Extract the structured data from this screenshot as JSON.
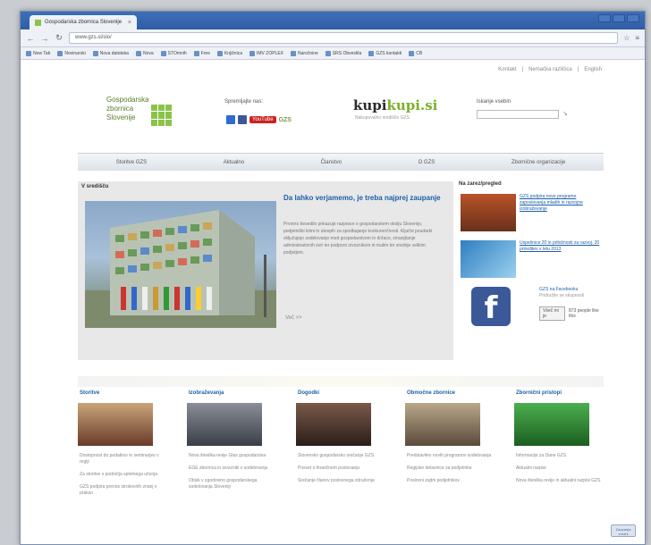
{
  "browser": {
    "tab_title": "Gospodarska zbornica Slovenije",
    "url": "www.gzs.si/slo/",
    "bookmarks": [
      "New Tab",
      "Novinarski",
      "Nova datoteka",
      "Nova",
      "STOmnih",
      "Free",
      "Knjižnica",
      "IMV ZOPLEX",
      "Naročnine",
      "SRS Obvestila",
      "GZS kontakti",
      "CB"
    ]
  },
  "site": {
    "top_links": [
      "Kontakt",
      "Nemačka različica",
      "English"
    ],
    "logo_lines": [
      "Gospodarska",
      "zbornica",
      "Slovenije"
    ],
    "social_label": "Spremljajte nas:",
    "youtube_label": "YouTube",
    "gzs_label": "GZS",
    "kupi_part1": "kupi",
    "kupi_part2": "kupi.si",
    "kupi_sub": "Nakupovalno središče GZS",
    "search_label": "Iskanje vsebin",
    "search_placeholder": ""
  },
  "nav": [
    "Storitve GZS",
    "Aktualno",
    "Članstvo",
    "O GZS",
    "Zbornične organizacije"
  ],
  "featured": {
    "section": "V središču",
    "headline": "Da lahko verjamemo, je treba najprej zaupanje",
    "body": "Prvotno besedilo prikazuje razpravo o gospodarskem okolju Slovenije, podjetniški klimi in ukrepih za spodbujanje konkurenčnosti. Ključni poudarki vključujejo sodelovanje med gospodarstvom in državo, zmanjšanje administrativnih ovir ter podporo izvoznikom in malim ter srednje velikim podjetjem.",
    "more": "Več >>"
  },
  "right": {
    "section": "Na zarez/pregled",
    "items": [
      "GZS podpira nove programe zaposlovanja mladih in razvojne izobraževanje",
      "Uspešnice 20 in priložnosti za razvoj. 20 prireditev v letu 2013"
    ],
    "fb_title": "GZS na Facebooku",
    "fb_sub": "Pridružite se skupnosti",
    "fb_like": "Všeč mi je",
    "fb_count": "873 people like this"
  },
  "columns": [
    {
      "title": "Storitve",
      "items": [
        "Dostopnost do podatkov in seminarjev v regiji",
        "Za storitve s področja spletnega učenja",
        "GZS podpira prenos strokovnih znanj v prakso"
      ]
    },
    {
      "title": "Izobraževanja",
      "items": [
        "Nova številka revije Glas gospodarstva",
        "EGE zbornica in izvozniki v sodelovanju",
        "Obisk v zgodovino gospodarskega sodelovanja Sloveniji"
      ]
    },
    {
      "title": "Dogodki",
      "items": [
        "Slovensko gospodarsko srečanje GZS",
        "Posvet o finančnem poslovanju",
        "Srečanje članov poslovnega združenja"
      ]
    },
    {
      "title": "Območne zbornice",
      "items": [
        "Predstavitev novih programov sodelovanja",
        "Regijske delavnice za podjetnike",
        "Poslovni zajtrk podjetnikov"
      ]
    },
    {
      "title": "Zbornični pristopi",
      "items": [
        "Informacije za člane GZS",
        "Aktualni razpisi",
        "Nova številka revije in aktualni razpisi GZS"
      ]
    }
  ],
  "badge": "Zaupanja vredni"
}
